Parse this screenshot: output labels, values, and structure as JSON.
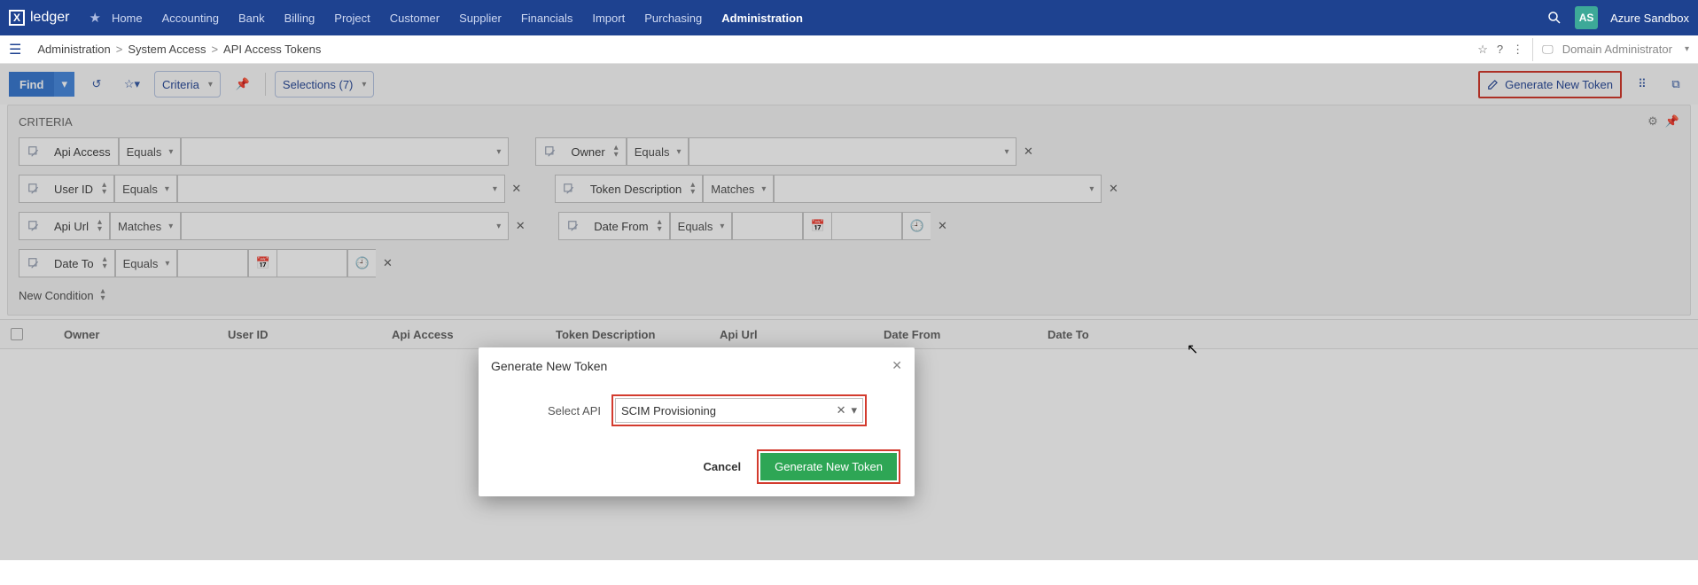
{
  "topnav": {
    "logo_text": "ledger",
    "items": [
      "Home",
      "Accounting",
      "Bank",
      "Billing",
      "Project",
      "Customer",
      "Supplier",
      "Financials",
      "Import",
      "Purchasing",
      "Administration"
    ],
    "active_index": 10,
    "avatar_initials": "AS",
    "tenant": "Azure Sandbox"
  },
  "breadcrumb": {
    "parts": [
      "Administration",
      "System Access",
      "API Access Tokens"
    ],
    "role": "Domain Administrator"
  },
  "toolbar": {
    "find_label": "Find",
    "criteria_label": "Criteria",
    "selections_label": "Selections (7)",
    "generate_label": "Generate New Token"
  },
  "criteria": {
    "title": "CRITERIA",
    "new_condition": "New Condition",
    "rows": [
      [
        {
          "field": "Api Access",
          "op": "Equals",
          "hasUpDown": false,
          "wide": true
        },
        {
          "field": "Owner",
          "op": "Equals",
          "hasUpDown": true,
          "wide": true,
          "closable": true
        }
      ],
      [
        {
          "field": "User ID",
          "op": "Equals",
          "hasUpDown": true,
          "wide": true,
          "closable": true
        },
        {
          "field": "Token Description",
          "op": "Matches",
          "hasUpDown": true,
          "wide": true,
          "closable": true
        }
      ],
      [
        {
          "field": "Api Url",
          "op": "Matches",
          "hasUpDown": true,
          "wide": true,
          "closable": true
        },
        {
          "field": "Date From",
          "op": "Equals",
          "hasUpDown": true,
          "date": true,
          "closable": true
        }
      ],
      [
        {
          "field": "Date To",
          "op": "Equals",
          "hasUpDown": true,
          "date": true,
          "closable": true
        }
      ]
    ]
  },
  "grid": {
    "columns": [
      "Owner",
      "User ID",
      "Api Access",
      "Token Description",
      "Api Url",
      "Date From",
      "Date To"
    ]
  },
  "modal": {
    "title": "Generate New Token",
    "field_label": "Select API",
    "selected_value": "SCIM Provisioning",
    "cancel": "Cancel",
    "submit": "Generate New Token"
  }
}
